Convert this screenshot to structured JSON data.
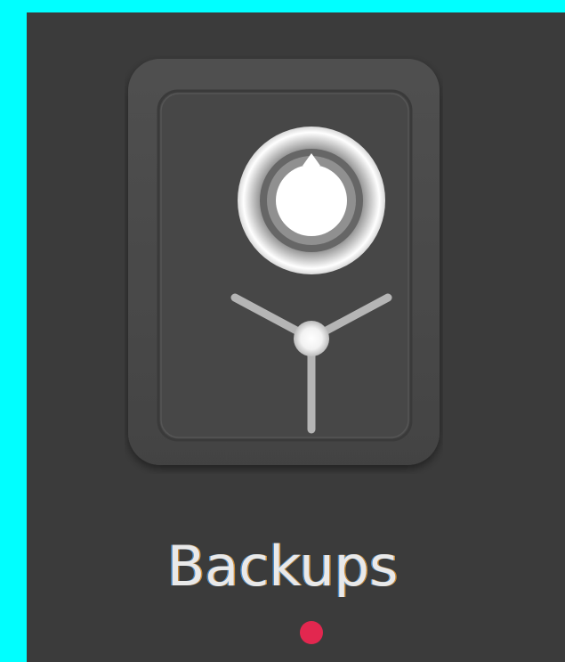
{
  "launcher_item": {
    "label": "Backups",
    "icon": "safe-vault-icon",
    "running_indicator": "running-indicator-dot"
  },
  "colors": {
    "screen_edge": "#00ffff",
    "panel_background": "#3b3b3b",
    "icon_body": "#4a4a4a",
    "label_text": "#e9e9e9",
    "running_dot": "#e2274f"
  }
}
